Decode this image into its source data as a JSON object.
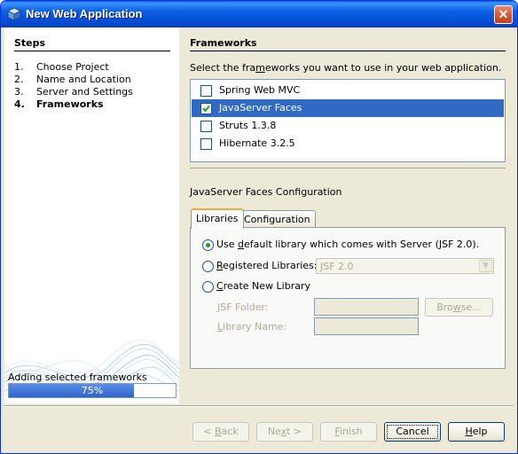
{
  "window": {
    "title": "New Web Application",
    "title_icon": "netbeans-cube-icon",
    "close_glyph": "✕"
  },
  "steps": {
    "header": "Steps",
    "items": [
      {
        "num": "1.",
        "label": "Choose Project",
        "current": false
      },
      {
        "num": "2.",
        "label": "Name and Location",
        "current": false
      },
      {
        "num": "3.",
        "label": "Server and Settings",
        "current": false
      },
      {
        "num": "4.",
        "label": "Frameworks",
        "current": true
      }
    ]
  },
  "progress": {
    "label": "Adding selected frameworks",
    "percent": 75,
    "text": "75%"
  },
  "frameworks": {
    "header": "Frameworks",
    "instruction": "Select the frameworks you want to use in your web application.",
    "items": [
      {
        "label": "Spring Web MVC",
        "checked": false,
        "selected": false
      },
      {
        "label": "JavaServer Faces",
        "checked": true,
        "selected": true
      },
      {
        "label": "Struts 1.3.8",
        "checked": false,
        "selected": false
      },
      {
        "label": "Hibernate 3.2.5",
        "checked": false,
        "selected": false
      }
    ]
  },
  "config": {
    "label": "JavaServer Faces Configuration",
    "tabs": [
      {
        "label": "Libraries",
        "active": true
      },
      {
        "label": "Configuration",
        "active": false
      }
    ],
    "options": {
      "default_library": "Use default library which comes with Server (JSF 2.0).",
      "registered_libraries": "Registered Libraries:",
      "registered_value": "JSF 2.0",
      "create_new": "Create New Library",
      "selected": "default_library"
    },
    "jsf_folder_label": "JSF Folder:",
    "jsf_folder_value": "",
    "library_name_label": "Library Name:",
    "library_name_value": "",
    "browse_label": "Browse..."
  },
  "buttons": {
    "back": "< Back",
    "next": "Next >",
    "finish": "Finish",
    "cancel": "Cancel",
    "help": "Help"
  },
  "colors": {
    "title_bar": "#0a5fe4",
    "selection": "#316ac5",
    "progress_fill": "#2e62c9",
    "dialog_bg": "#ece9d8"
  }
}
